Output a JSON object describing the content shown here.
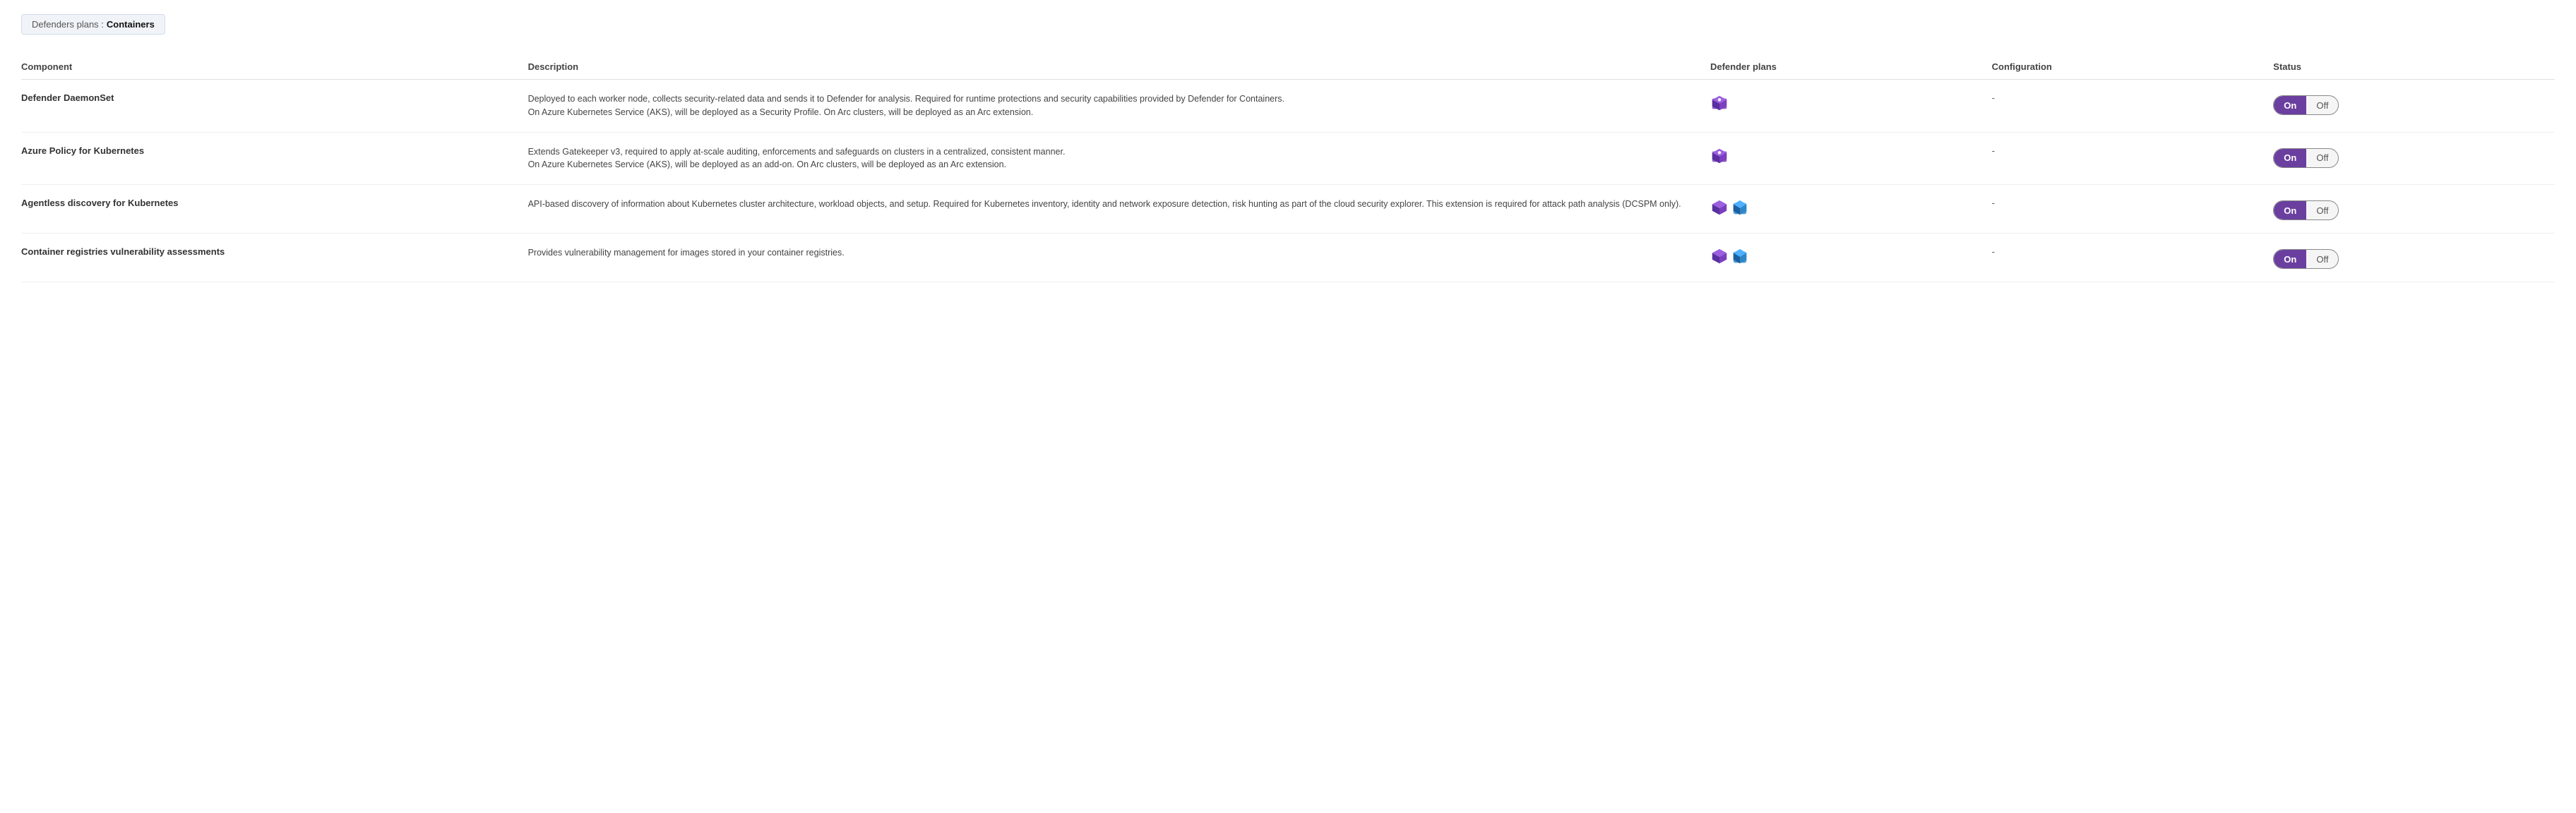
{
  "breadcrumb": {
    "prefix": "Defenders plans :",
    "current": "Containers"
  },
  "table": {
    "columns": [
      "Component",
      "Description",
      "Defender plans",
      "Configuration",
      "Status"
    ],
    "rows": [
      {
        "id": "defender-daemonset",
        "component": "Defender DaemonSet",
        "description": "Deployed to each worker node, collects security-related data and sends it to Defender for analysis. Required for runtime protections and security capabilities provided by Defender for Containers.\nOn Azure Kubernetes Service (AKS), will be deployed as a Security Profile. On Arc clusters, will be deployed as an Arc extension.",
        "defender_plans_icon": "container-plan-icon",
        "configuration": "-",
        "status_on": "On",
        "status_off": "Off",
        "status_active": "on"
      },
      {
        "id": "azure-policy-kubernetes",
        "component": "Azure Policy for Kubernetes",
        "description": "Extends Gatekeeper v3, required to apply at-scale auditing, enforcements and safeguards on clusters in a centralized, consistent manner.\nOn Azure Kubernetes Service (AKS), will be deployed as an add-on. On Arc clusters, will be deployed as an Arc extension.",
        "defender_plans_icon": "container-plan-icon",
        "configuration": "-",
        "status_on": "On",
        "status_off": "Off",
        "status_active": "on"
      },
      {
        "id": "agentless-discovery-kubernetes",
        "component": "Agentless discovery for Kubernetes",
        "description": "API-based discovery of information about Kubernetes cluster architecture, workload objects, and setup. Required for Kubernetes inventory, identity and network exposure detection, risk hunting as part of the cloud security explorer. This extension is required for attack path analysis (DCSPM only).",
        "defender_plans_icon": "multi-plan-icon",
        "configuration": "-",
        "status_on": "On",
        "status_off": "Off",
        "status_active": "on"
      },
      {
        "id": "container-registries-vulnerability",
        "component": "Container registries vulnerability assessments",
        "description": "Provides vulnerability management for images stored in your container registries.",
        "defender_plans_icon": "multi-plan-icon",
        "configuration": "-",
        "status_on": "On",
        "status_off": "Off",
        "status_active": "on"
      }
    ]
  }
}
